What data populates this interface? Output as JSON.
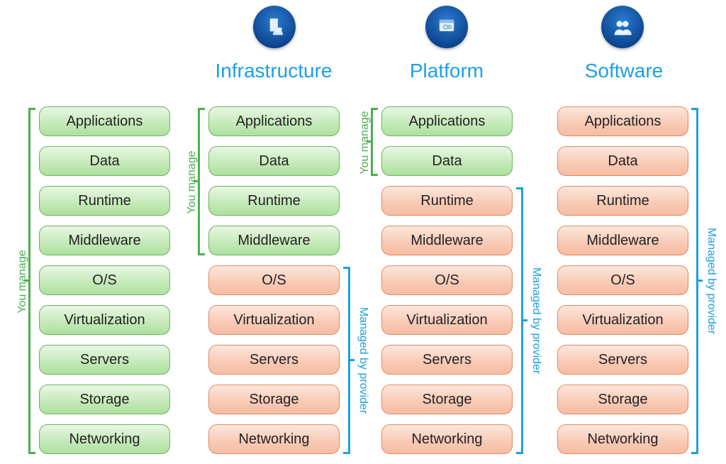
{
  "columns": [
    {
      "key": "onprem",
      "title": ""
    },
    {
      "key": "iaas",
      "title": "Infrastructure"
    },
    {
      "key": "paas",
      "title": "Platform"
    },
    {
      "key": "saas",
      "title": "Software"
    }
  ],
  "layers": [
    "Applications",
    "Data",
    "Runtime",
    "Middleware",
    "O/S",
    "Virtualization",
    "Servers",
    "Storage",
    "Networking"
  ],
  "managed_by_you_label": "You manage",
  "managed_by_provider_label": "Managed by provider",
  "colors": {
    "you": "#4caf50",
    "provider": "#1ba0e6"
  },
  "cells": {
    "onprem": [
      "you",
      "you",
      "you",
      "you",
      "you",
      "you",
      "you",
      "you",
      "you"
    ],
    "iaas": [
      "you",
      "you",
      "you",
      "you",
      "provider",
      "provider",
      "provider",
      "provider",
      "provider"
    ],
    "paas": [
      "you",
      "you",
      "provider",
      "provider",
      "provider",
      "provider",
      "provider",
      "provider",
      "provider"
    ],
    "saas": [
      "provider",
      "provider",
      "provider",
      "provider",
      "provider",
      "provider",
      "provider",
      "provider",
      "provider"
    ]
  }
}
